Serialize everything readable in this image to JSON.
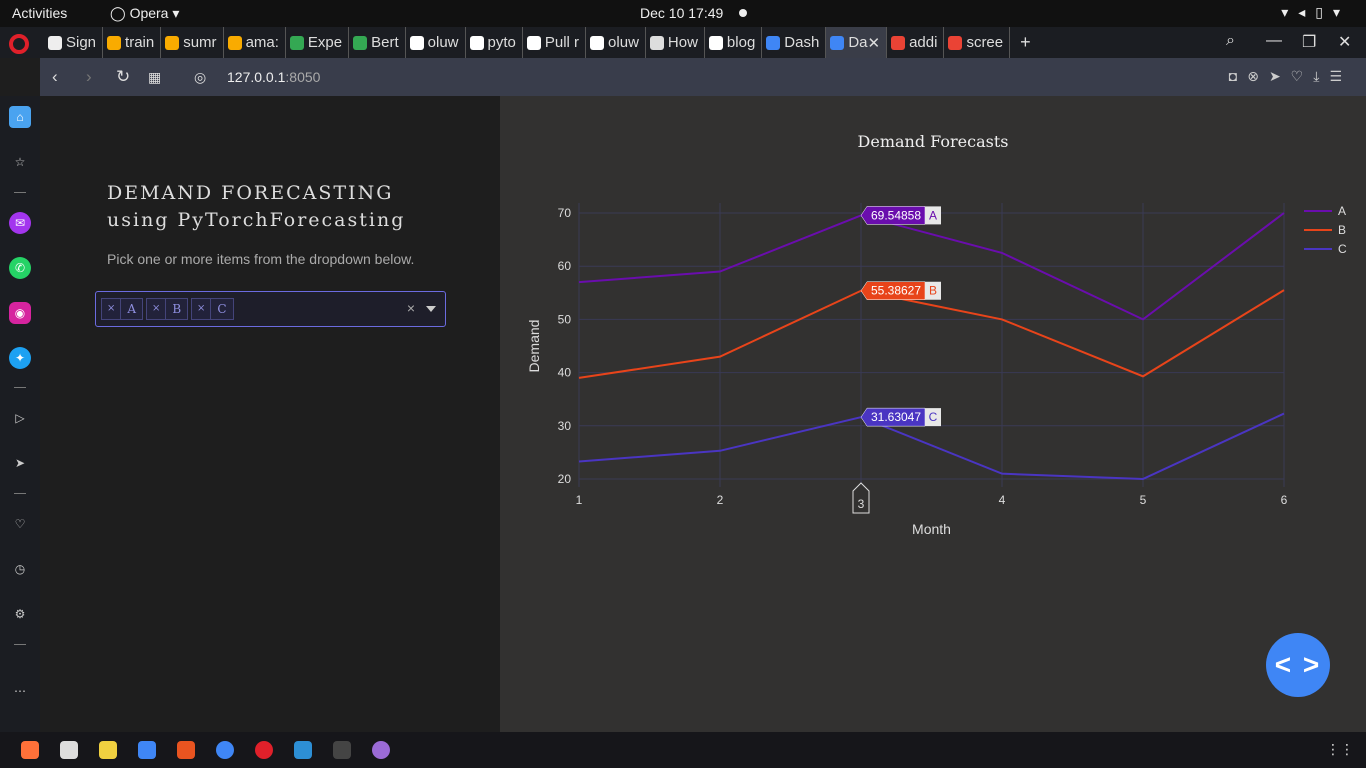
{
  "system": {
    "activities": "Activities",
    "browser_name": "Opera",
    "clock": "Dec 10  17:49",
    "tray_icons": [
      "wifi-icon",
      "volume-icon",
      "battery-icon",
      "power-icon"
    ]
  },
  "tabs": [
    {
      "label": "Sign",
      "icon": "page-icon",
      "color": "#eeeeee"
    },
    {
      "label": "train",
      "icon": "colab-icon",
      "color": "#f9ab00"
    },
    {
      "label": "sumr",
      "icon": "colab-icon",
      "color": "#f9ab00"
    },
    {
      "label": "ama:",
      "icon": "colab-icon",
      "color": "#f9ab00"
    },
    {
      "label": "Expe",
      "icon": "drive-icon",
      "color": "#34a853"
    },
    {
      "label": "Bert",
      "icon": "drive-icon",
      "color": "#34a853"
    },
    {
      "label": "oluw",
      "icon": "github-icon",
      "color": "#ffffff"
    },
    {
      "label": "pyto",
      "icon": "box-icon",
      "color": "#ffffff"
    },
    {
      "label": "Pull r",
      "icon": "github-icon",
      "color": "#ffffff"
    },
    {
      "label": "oluw",
      "icon": "github-icon",
      "color": "#ffffff"
    },
    {
      "label": "How",
      "icon": "x-icon",
      "color": "#dddddd"
    },
    {
      "label": "blog",
      "icon": "github-icon",
      "color": "#ffffff"
    },
    {
      "label": "Dash",
      "icon": "chart-icon",
      "color": "#3f86f5"
    },
    {
      "label": "Da",
      "icon": "chart-icon",
      "color": "#3f86f5",
      "active": true
    },
    {
      "label": "addi",
      "icon": "google-icon",
      "color": "#ea4335"
    },
    {
      "label": "scree",
      "icon": "google-icon",
      "color": "#ea4335"
    }
  ],
  "address": {
    "host": "127.0.0.1",
    "port": ":8050"
  },
  "app": {
    "title_line1": "DEMAND FORECASTING",
    "title_line2": "using PyTorchForecasting",
    "hint": "Pick one or more items from the dropdown below.",
    "selected_items": [
      "A",
      "B",
      "C"
    ],
    "chip_remove": "×",
    "clear_symbol": "×"
  },
  "chart_data": {
    "type": "line",
    "title": "Demand Forecasts",
    "xlabel": "Month",
    "ylabel": "Demand",
    "x": [
      1,
      2,
      3,
      4,
      5,
      6
    ],
    "ylim": [
      20,
      70
    ],
    "yticks": [
      20,
      30,
      40,
      50,
      60,
      70
    ],
    "legend_position": "top-right",
    "hover_x": 3,
    "series": [
      {
        "name": "A",
        "color": "#6a0dad",
        "values": [
          57.0,
          59.0,
          69.54858,
          62.5,
          50.0,
          70.0
        ],
        "hover_label": "69.54858"
      },
      {
        "name": "B",
        "color": "#e8441a",
        "values": [
          39.0,
          43.0,
          55.38627,
          50.0,
          39.3,
          55.5
        ],
        "hover_label": "55.38627"
      },
      {
        "name": "C",
        "color": "#4a35c2",
        "values": [
          23.3,
          25.3,
          31.63047,
          21.0,
          20.0,
          32.3
        ],
        "hover_label": "31.63047"
      }
    ]
  },
  "fab": {
    "label": "< >"
  },
  "colors": {
    "accent": "#3f86f5",
    "dropdown_border": "#6b6be0",
    "panel_right": "#323130",
    "panel_left": "#1e1e1e"
  }
}
